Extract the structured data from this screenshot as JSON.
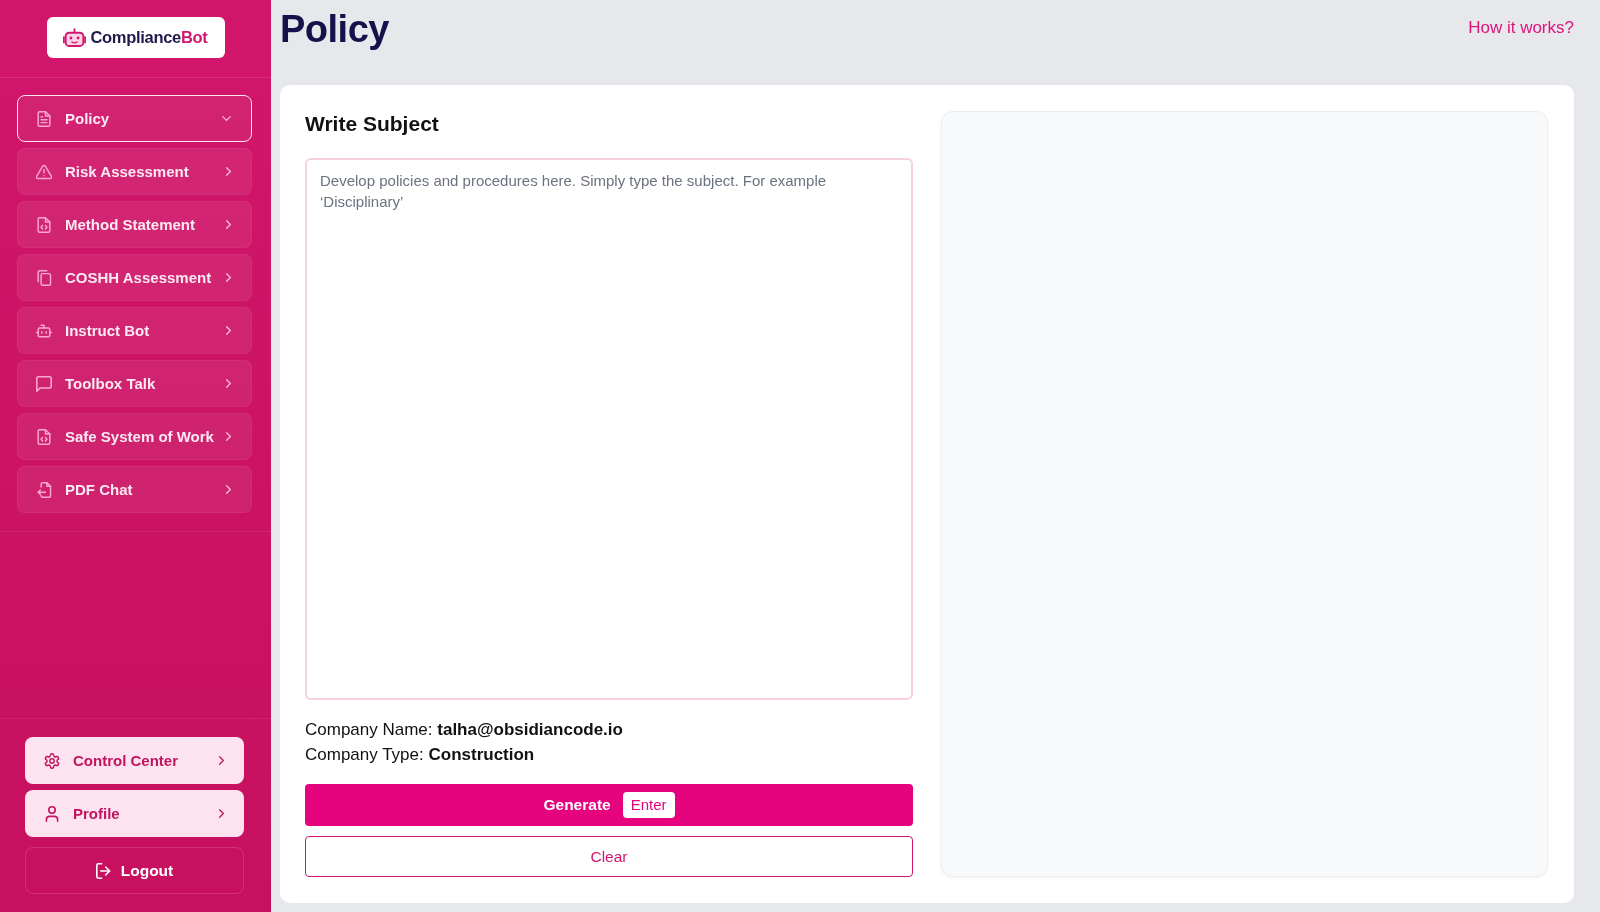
{
  "sidebar": {
    "logo": {
      "name": "Compliance",
      "accent": "Bot"
    },
    "nav_items": [
      {
        "label": "Policy",
        "selected": true,
        "expanded": true
      },
      {
        "label": "Risk Assessment",
        "selected": false,
        "expanded": false
      },
      {
        "label": "Method Statement",
        "selected": false,
        "expanded": false
      },
      {
        "label": "COSHH Assessment",
        "selected": false,
        "expanded": false
      },
      {
        "label": "Instruct Bot",
        "selected": false,
        "expanded": false
      },
      {
        "label": "Toolbox Talk",
        "selected": false,
        "expanded": false
      },
      {
        "label": "Safe System of Work",
        "selected": false,
        "expanded": false
      },
      {
        "label": "PDF Chat",
        "selected": false,
        "expanded": false
      }
    ],
    "footer_items": [
      {
        "label": "Control Center"
      },
      {
        "label": "Profile"
      }
    ],
    "logout": {
      "label": "Logout"
    }
  },
  "header": {
    "title": "Policy",
    "help_link": "How it works?"
  },
  "form": {
    "heading": "Write Subject",
    "subject": {
      "placeholder": "Develop policies and procedures here. Simply type the subject. For example ‘Disciplinary’"
    },
    "details": [
      {
        "label": "Company Name:",
        "value": "talha@obsidiancode.io"
      },
      {
        "label": "Company Type:",
        "value": "Construction"
      }
    ],
    "generate_button": {
      "label": "Generate",
      "shortcut": "Enter"
    },
    "clear_button": {
      "label": "Clear"
    }
  }
}
